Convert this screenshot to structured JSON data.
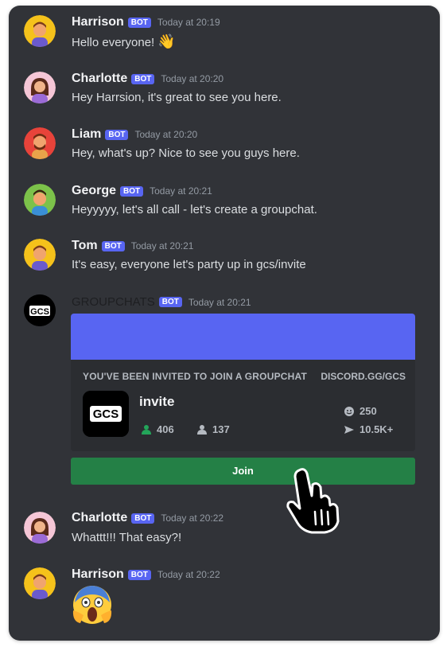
{
  "messages": [
    {
      "author": "Harrison",
      "badge": "BOT",
      "time": "Today at 20:19",
      "text": "Hello everyone!"
    },
    {
      "author": "Charlotte",
      "badge": "BOT",
      "time": "Today at 20:20",
      "text": "Hey Harrsion, it's great to see you here."
    },
    {
      "author": "Liam",
      "badge": "BOT",
      "time": "Today at 20:20",
      "text": "Hey, what's up? Nice to see you guys here."
    },
    {
      "author": "George",
      "badge": "BOT",
      "time": "Today at 20:21",
      "text": "Heyyyyy, let's all call - let's create a groupchat."
    },
    {
      "author": "Tom",
      "badge": "BOT",
      "time": "Today at 20:21",
      "text": "It's easy, everyone let's party up in gcs/invite"
    },
    {
      "author": "GROUPCHATS",
      "badge": "BOT",
      "time": "Today at 20:21",
      "text": ""
    },
    {
      "author": "Charlotte",
      "badge": "BOT",
      "time": "Today at 20:22",
      "text": "Whattt!!! That easy?!"
    },
    {
      "author": "Harrison",
      "badge": "BOT",
      "time": "Today at 20:22",
      "text": ""
    }
  ],
  "invite": {
    "title": "YOU'VE BEEN INVITED TO JOIN A GROUPCHAT",
    "link": "DISCORD.GG/GCS",
    "logo_text": "GCS",
    "name": "invite",
    "online": "406",
    "members": "137",
    "boost_count": "250",
    "shares": "10.5K+",
    "join_label": "Join",
    "colors": {
      "banner": "#5865f2",
      "join": "#248046",
      "online": "#23a55a"
    }
  },
  "icons": [
    "waving-hand-emoji",
    "screaming-face-emoji",
    "pointing-hand-cursor",
    "online-members-icon",
    "members-icon",
    "smiley-icon",
    "send-arrow-icon"
  ]
}
